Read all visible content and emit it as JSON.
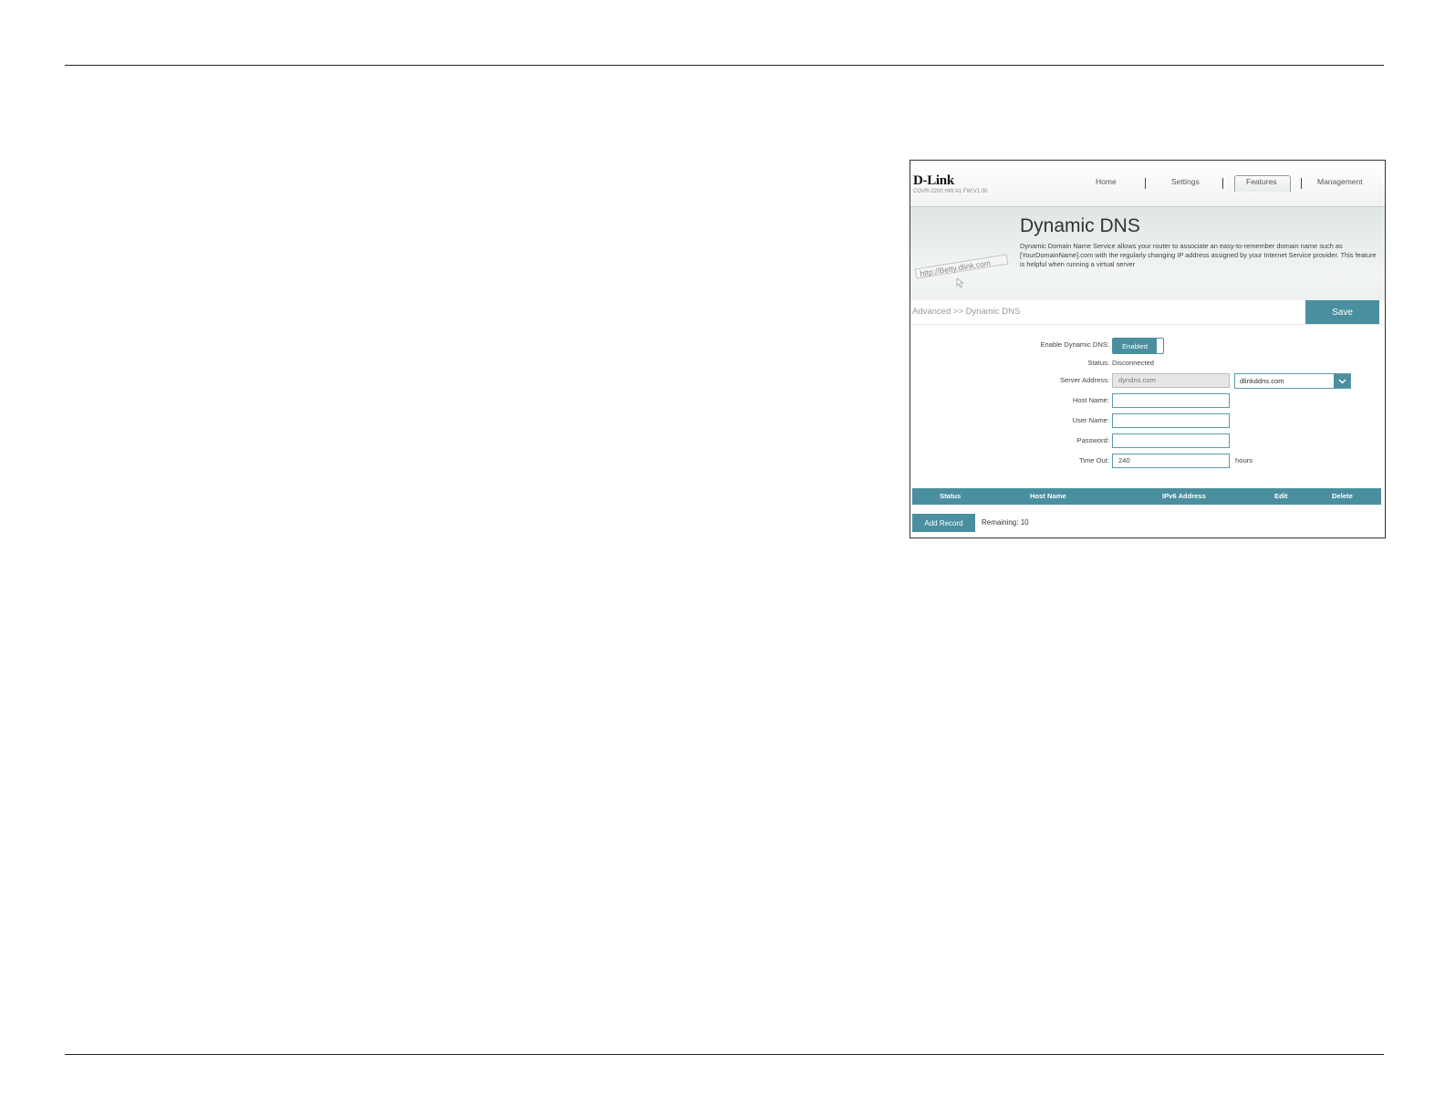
{
  "header": {
    "logo": "D-Link",
    "model": "COVR-2200 HW:A1 FW:V1.00",
    "nav": [
      {
        "label": "Home"
      },
      {
        "label": "Settings"
      },
      {
        "label": "Features",
        "active": true
      },
      {
        "label": "Management"
      }
    ]
  },
  "banner": {
    "title": "Dynamic DNS",
    "description": "Dynamic Domain Name Service allows your router to associate an easy-to-remember domain name such as [YourDomainName].com with the regularly changing IP address assigned by your Internet Service provider. This feature is helpful when running a virtual server",
    "art_text": "http://Betty.dlink.com"
  },
  "breadcrumb": "Advanced >> Dynamic DNS",
  "save_label": "Save",
  "form": {
    "enable_label": "Enable Dynamic DNS:",
    "enable_value": "Enabled",
    "status_label": "Status:",
    "status_value": "Disconnected",
    "server_label": "Server Address:",
    "server_value": "dyndns.com",
    "server_select_value": "dlinkddns.com",
    "host_label": "Host Name:",
    "host_value": "",
    "user_label": "User Name:",
    "user_value": "",
    "password_label": "Password:",
    "password_value": "",
    "timeout_label": "Time Out:",
    "timeout_value": "240",
    "timeout_unit": "hours"
  },
  "table": {
    "columns": [
      "Status",
      "Host Name",
      "IPv6 Address",
      "Edit",
      "Delete"
    ]
  },
  "add_record_label": "Add Record",
  "remaining_label": "Remaining: 10",
  "colors": {
    "accent": "#4a8fa0"
  }
}
